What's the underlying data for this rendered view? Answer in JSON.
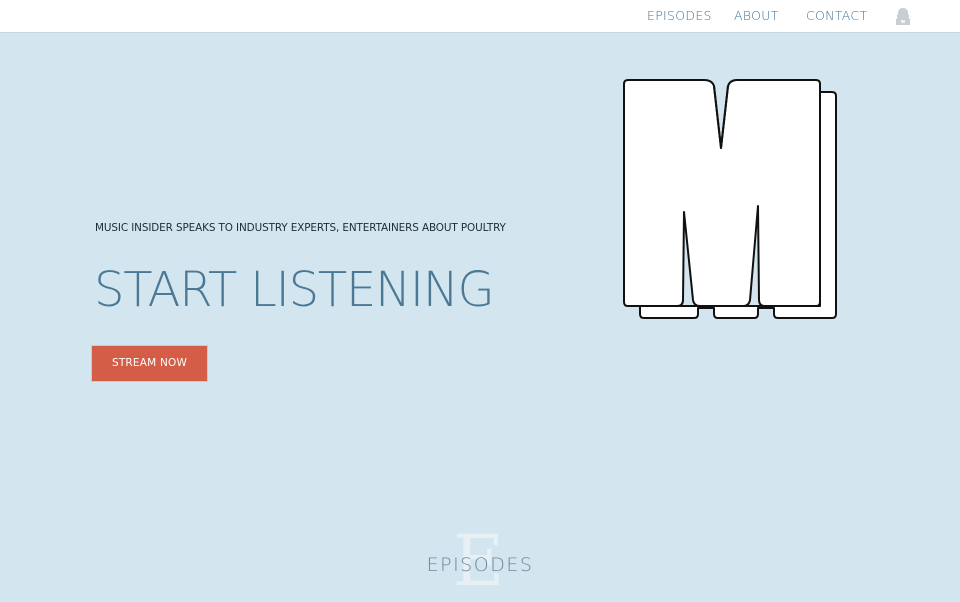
{
  "nav": {
    "links": [
      "EPISODES",
      "ABOUT",
      "CONTACT"
    ],
    "user_icon": "user-icon"
  },
  "hero": {
    "tagline": "MUSIC INSIDER SPEAKS TO INDUSTRY EXPERTS, ENTERTAINERS ABOUT POULTRY",
    "headline": "START LISTENING",
    "cta_label": "STREAM NOW",
    "logo_icon": "m-logo"
  },
  "episodes": {
    "big_letter": "E",
    "label": "EPISODES"
  },
  "colors": {
    "background": "#d3e6ef",
    "nav_link": "#3f7094",
    "headline": "#4b7895",
    "cta": "#d35d47"
  }
}
